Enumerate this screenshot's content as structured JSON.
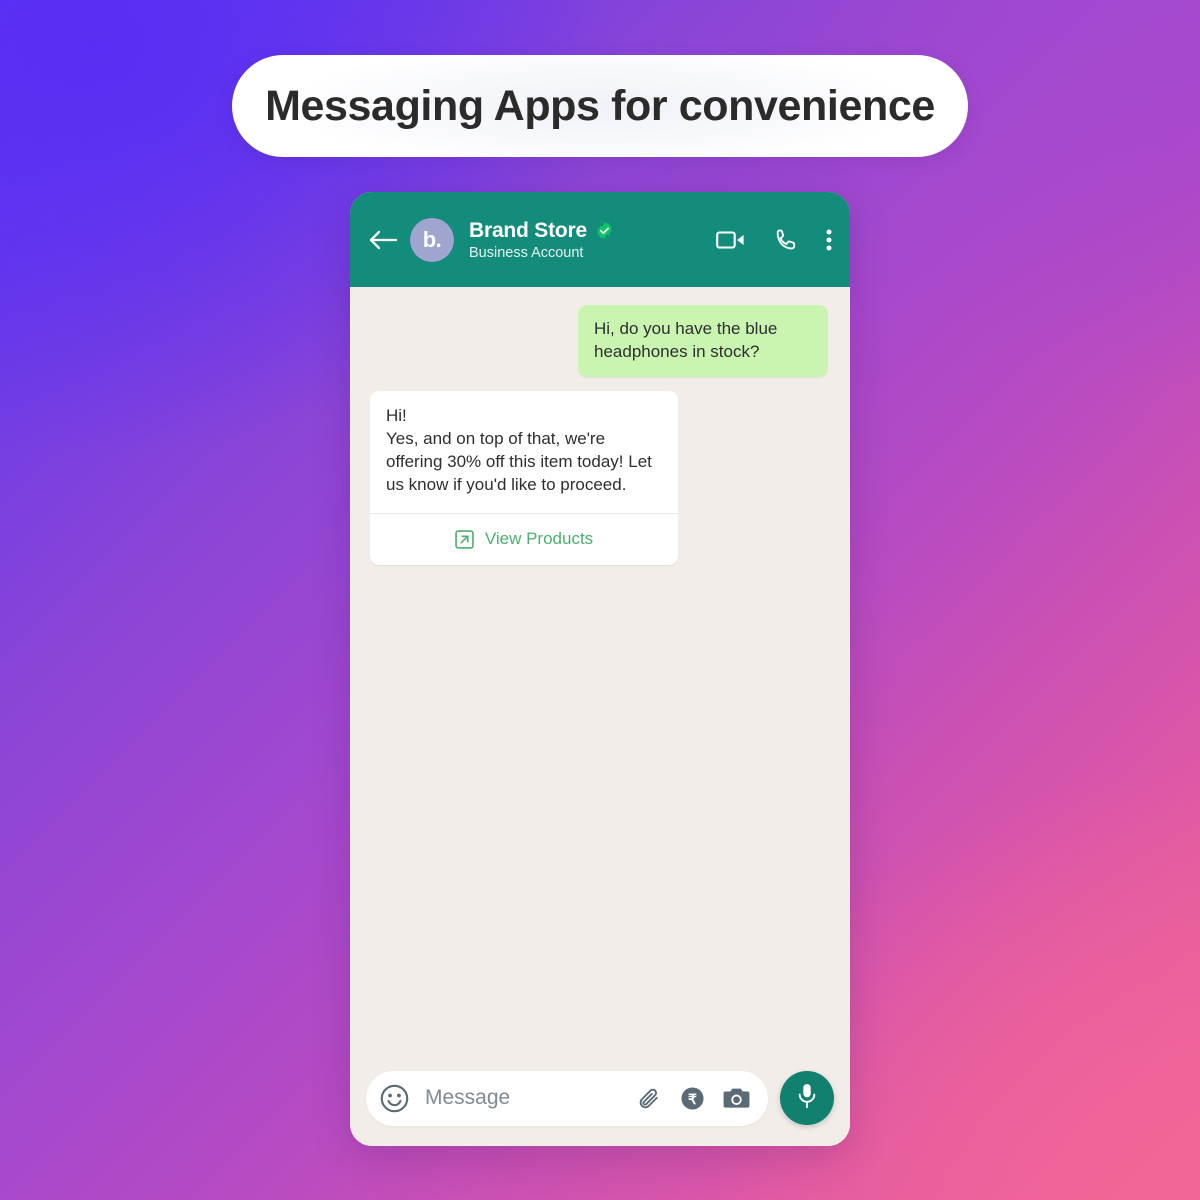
{
  "page": {
    "title": "Messaging Apps for convenience",
    "background_gradient_from": "#5a33f0",
    "background_gradient_mid": "#a348cf",
    "background_gradient_to": "#f26796"
  },
  "chat": {
    "header": {
      "back_icon": "back-arrow-icon",
      "avatar_initials": "b.",
      "avatar_color": "#9fa5ce",
      "name": "Brand Store",
      "verified": true,
      "verified_color": "#0dc268",
      "subtitle": "Business Account",
      "header_color": "#148c7c",
      "actions": [
        {
          "name": "video-call",
          "icon": "video-camera-icon"
        },
        {
          "name": "voice-call",
          "icon": "phone-icon"
        },
        {
          "name": "more-options",
          "icon": "more-vertical-icon"
        }
      ]
    },
    "background_color": "#f2ede8",
    "messages": [
      {
        "direction": "outgoing",
        "text": "Hi, do you have the blue headphones in stock?",
        "bubble_color": "#c9f5b1"
      },
      {
        "direction": "incoming",
        "greeting": "Hi!",
        "text": "Yes, and on top of that, we're offering 30% off this item today! Let us know if you'd like to proceed.",
        "bubble_color": "#ffffff",
        "cta_label": "View Products",
        "cta_icon": "external-link-icon",
        "cta_color": "#4caf72"
      }
    ],
    "input": {
      "emoji_icon": "emoji-smiley-icon",
      "placeholder": "Message",
      "value": "",
      "attach_icon": "paperclip-icon",
      "payment_icon": "rupee-payment-icon",
      "camera_icon": "camera-icon",
      "mic_icon": "microphone-icon",
      "mic_button_color": "#11806f"
    }
  }
}
